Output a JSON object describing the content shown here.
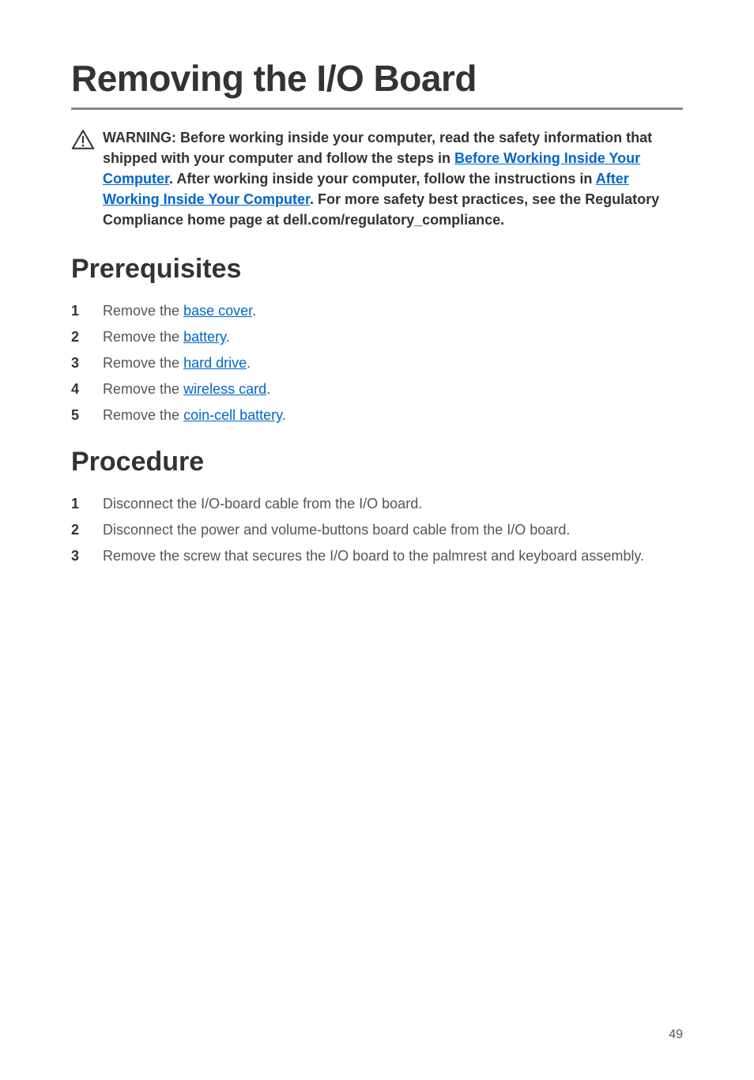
{
  "page": {
    "title": "Removing the I/O Board",
    "number": "49"
  },
  "warning": {
    "label": "WARNING:",
    "part1": " Before working inside your computer, read the safety information that shipped with your computer and follow the steps in ",
    "link1": "Before Working Inside Your Computer",
    "part2": ". After working inside your computer, follow the instructions in ",
    "link2": "After Working Inside Your Computer",
    "part3": ". For more safety best practices, see the Regulatory Compliance home page at dell.com/regulatory_compliance."
  },
  "sections": {
    "prerequisites": {
      "heading": "Prerequisites",
      "steps": [
        {
          "pre": "Remove the ",
          "link": "base cover",
          "post": "."
        },
        {
          "pre": "Remove the ",
          "link": "battery",
          "post": "."
        },
        {
          "pre": "Remove the ",
          "link": "hard drive",
          "post": "."
        },
        {
          "pre": "Remove the ",
          "link": "wireless card",
          "post": "."
        },
        {
          "pre": "Remove the ",
          "link": "coin-cell battery",
          "post": "."
        }
      ]
    },
    "procedure": {
      "heading": "Procedure",
      "steps": [
        {
          "text": "Disconnect the I/O-board cable from the I/O board."
        },
        {
          "text": "Disconnect the power and volume-buttons board cable from the I/O board."
        },
        {
          "text": "Remove the screw that secures the I/O board to the palmrest and keyboard assembly."
        }
      ]
    }
  }
}
